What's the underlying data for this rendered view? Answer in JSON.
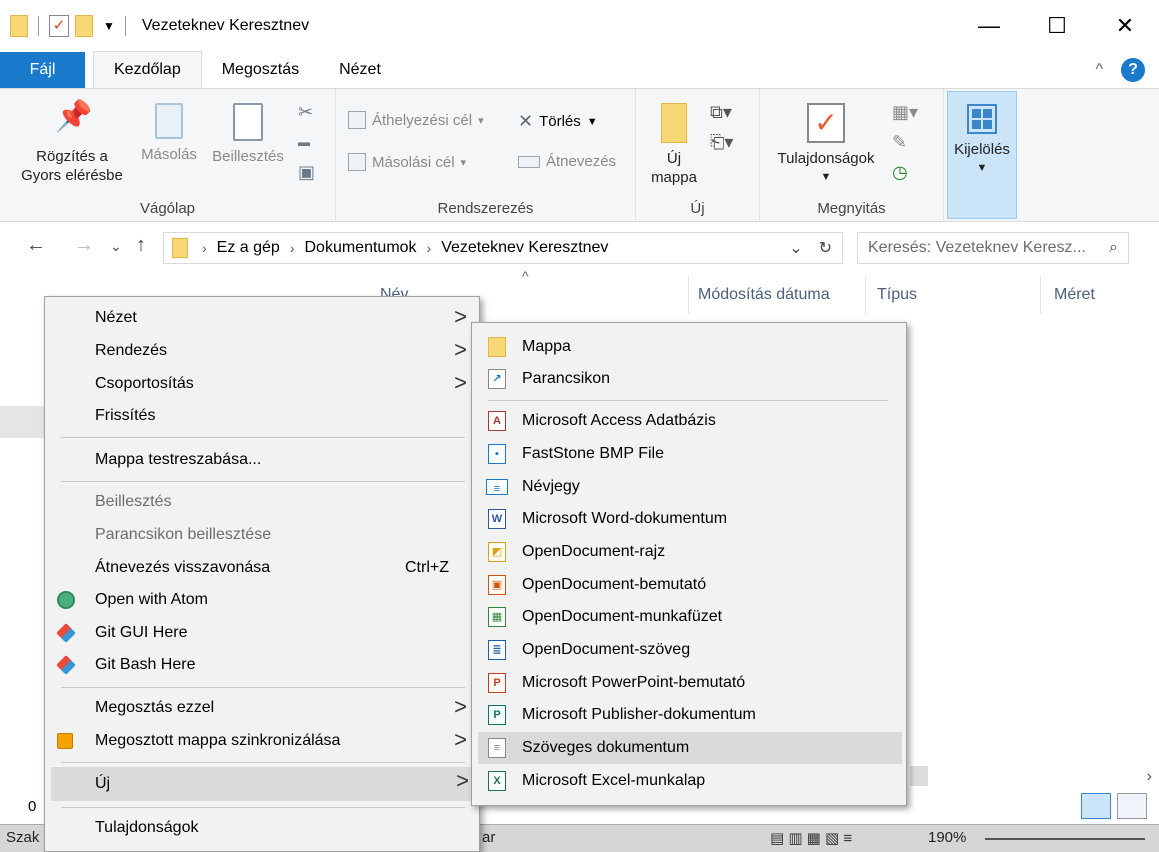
{
  "window": {
    "title": "Vezeteknev Keresztnev",
    "minimize": "—",
    "maximize": "☐",
    "close": "✕"
  },
  "tabs": {
    "file": "Fájl",
    "home": "Kezdőlap",
    "share": "Megosztás",
    "view": "Nézet",
    "collapse": "^",
    "help": "?"
  },
  "ribbon": {
    "clipboard": {
      "pin_line1": "Rögzítés a",
      "pin_line2": "Gyors elérésbe",
      "copy": "Másolás",
      "paste": "Beillesztés",
      "group": "Vágólap"
    },
    "organize": {
      "move_to": "Áthelyezési cél",
      "copy_to": "Másolási cél",
      "delete": "Törlés",
      "rename": "Átnevezés",
      "group": "Rendszerezés"
    },
    "new": {
      "new_folder_line1": "Új",
      "new_folder_line2": "mappa",
      "group": "Új"
    },
    "open": {
      "properties": "Tulajdonságok",
      "group": "Megnyitás"
    },
    "select": {
      "label": "Kijelölés"
    }
  },
  "address": {
    "crumbs": [
      "Ez a gép",
      "Dokumentumok",
      "Vezeteknev Keresztnev"
    ],
    "search_placeholder": "Keresés: Vezeteknev Keresz..."
  },
  "columns": {
    "name": "Név",
    "modified": "Módosítás dátuma",
    "type": "Típus",
    "size": "Méret"
  },
  "status": {
    "count": "0",
    "left_text": "Szak",
    "mid_text": "ar",
    "zoom": "190%"
  },
  "context_menu": {
    "items": [
      {
        "label": "Nézet",
        "arrow": ">"
      },
      {
        "label": "Rendezés",
        "arrow": ">"
      },
      {
        "label": "Csoportosítás",
        "arrow": ">"
      },
      {
        "label": "Frissítés"
      },
      {
        "label": "Mappa testreszabása..."
      },
      {
        "label": "Beillesztés"
      },
      {
        "label": "Parancsikon beillesztése"
      },
      {
        "label": "Átnevezés visszavonása",
        "shortcut": "Ctrl+Z"
      },
      {
        "label": "Open with Atom"
      },
      {
        "label": "Git GUI Here"
      },
      {
        "label": "Git Bash Here"
      },
      {
        "label": "Megosztás ezzel",
        "arrow": ">"
      },
      {
        "label": "Megosztott mappa szinkronizálása",
        "arrow": ">"
      },
      {
        "label": "Új",
        "arrow": ">"
      },
      {
        "label": "Tulajdonságok"
      }
    ]
  },
  "new_submenu": {
    "items": [
      {
        "label": "Mappa",
        "icon": "folder-icon"
      },
      {
        "label": "Parancsikon",
        "icon": "shortcut-icon"
      },
      {
        "label": "Microsoft Access Adatbázis",
        "icon": "access-icon"
      },
      {
        "label": "FastStone BMP File",
        "icon": "bmp-icon"
      },
      {
        "label": "Névjegy",
        "icon": "contact-icon"
      },
      {
        "label": "Microsoft Word-dokumentum",
        "icon": "word-icon"
      },
      {
        "label": "OpenDocument-rajz",
        "icon": "odg-icon"
      },
      {
        "label": "OpenDocument-bemutató",
        "icon": "odp-icon"
      },
      {
        "label": "OpenDocument-munkafüzet",
        "icon": "ods-icon"
      },
      {
        "label": "OpenDocument-szöveg",
        "icon": "odt-icon"
      },
      {
        "label": "Microsoft PowerPoint-bemutató",
        "icon": "powerpoint-icon"
      },
      {
        "label": "Microsoft Publisher-dokumentum",
        "icon": "publisher-icon"
      },
      {
        "label": "Szöveges dokumentum",
        "icon": "text-document-icon"
      },
      {
        "label": "Microsoft Excel-munkalap",
        "icon": "excel-icon"
      }
    ]
  },
  "colors": {
    "accent": "#1979ca",
    "menu_bg": "#f2f2f2",
    "menu_highlight": "#dadada",
    "ribbon_bg": "#f5f6f7"
  }
}
